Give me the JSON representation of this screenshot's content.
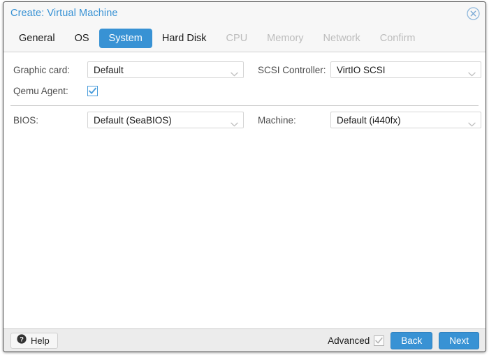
{
  "window": {
    "title": "Create: Virtual Machine",
    "close_icon": "close-circle-icon"
  },
  "tabs": [
    {
      "label": "General",
      "state": "enabled"
    },
    {
      "label": "OS",
      "state": "enabled"
    },
    {
      "label": "System",
      "state": "active"
    },
    {
      "label": "Hard Disk",
      "state": "enabled"
    },
    {
      "label": "CPU",
      "state": "disabled"
    },
    {
      "label": "Memory",
      "state": "disabled"
    },
    {
      "label": "Network",
      "state": "disabled"
    },
    {
      "label": "Confirm",
      "state": "disabled"
    }
  ],
  "form": {
    "graphic_card": {
      "label": "Graphic card:",
      "value": "Default",
      "icon": "chevron-down-icon"
    },
    "qemu_agent": {
      "label": "Qemu Agent:",
      "checked": true
    },
    "scsi_controller": {
      "label": "SCSI Controller:",
      "value": "VirtIO SCSI",
      "icon": "chevron-down-icon"
    },
    "bios": {
      "label": "BIOS:",
      "value": "Default (SeaBIOS)",
      "icon": "chevron-down-icon"
    },
    "machine": {
      "label": "Machine:",
      "value": "Default (i440fx)",
      "icon": "chevron-down-icon"
    }
  },
  "footer": {
    "help_label": "Help",
    "help_icon": "question-circle-icon",
    "advanced_label": "Advanced",
    "advanced_checked": true,
    "back_label": "Back",
    "next_label": "Next"
  },
  "colors": {
    "accent": "#3892d4",
    "title_text": "#3892d4",
    "disabled_tab": "#bcbcbc",
    "label_text": "#4d4d4d",
    "footer_bg": "#ececec"
  }
}
